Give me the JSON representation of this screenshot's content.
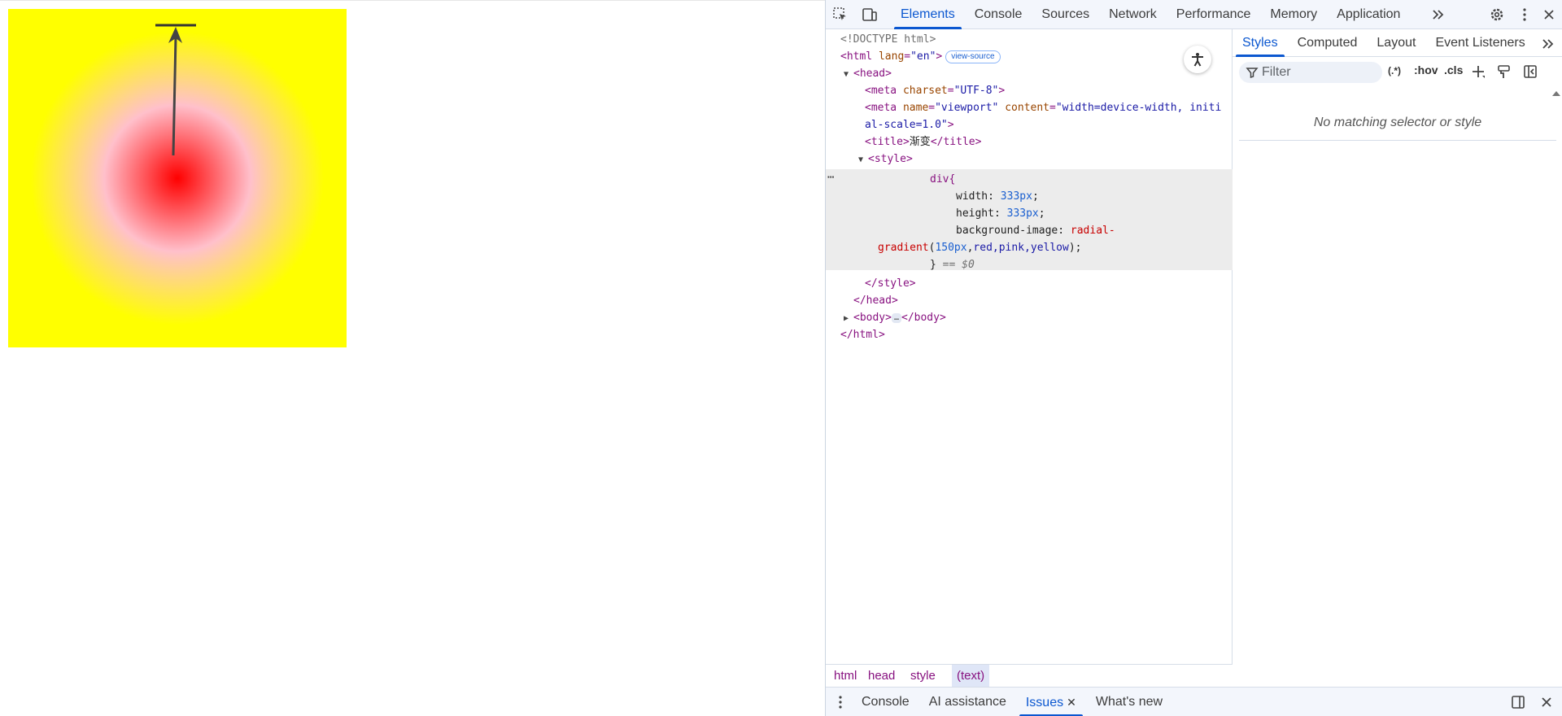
{
  "page": {
    "gradient": {
      "size": "333px",
      "stops": [
        "red",
        "pink",
        "yellow"
      ],
      "radius": "150px"
    }
  },
  "devtools": {
    "main_tabs": [
      {
        "label": "Elements",
        "active": true
      },
      {
        "label": "Console"
      },
      {
        "label": "Sources"
      },
      {
        "label": "Network"
      },
      {
        "label": "Performance"
      },
      {
        "label": "Memory"
      },
      {
        "label": "Application"
      }
    ],
    "dom": {
      "doctype": "<!DOCTYPE html>",
      "html_open": "<html",
      "lang_attr": "lang",
      "lang_val": "\"en\"",
      "html_close_bracket": ">",
      "view_source": "view-source",
      "head_open": "<head>",
      "meta1_open": "<meta",
      "meta1_attr": "charset",
      "meta1_val": "\"UTF-8\"",
      "meta1_close": ">",
      "meta2_open": "<meta",
      "meta2_attr1": "name",
      "meta2_val1": "\"viewport\"",
      "meta2_attr2": "content",
      "meta2_val2a": "\"width=device-width, initi",
      "meta2_val2b": "al-scale=1.0\"",
      "meta2_close": ">",
      "title_open": "<title>",
      "title_text": "渐变",
      "title_close": "</title>",
      "style_open": "<style>",
      "css_selector": "div{",
      "css_width_prop": "width: ",
      "css_width_val": "333px",
      "css_height_prop": "height: ",
      "css_height_val": "333px",
      "css_bg_prop": "background-image: ",
      "css_bg_fn_a": "radial-",
      "css_bg_fn_b": "gradient",
      "css_bg_args_px": "150px",
      "css_bg_args_colors": "red,pink,yellow",
      "css_close": "}",
      "css_dollar": " == $0",
      "style_close": "</style>",
      "head_close": "</head>",
      "body_open": "<body>",
      "body_ellipsis": "…",
      "body_close": "</body>",
      "html_close": "</html>"
    },
    "breadcrumbs": [
      {
        "label": "html"
      },
      {
        "label": "head"
      },
      {
        "label": "style"
      },
      {
        "label": "(text)",
        "active": true
      }
    ],
    "style_tabs": [
      {
        "label": "Styles",
        "active": true
      },
      {
        "label": "Computed"
      },
      {
        "label": "Layout"
      },
      {
        "label": "Event Listeners"
      }
    ],
    "filter": {
      "placeholder": "Filter",
      "regex_label": "(.*)",
      "hov_label": ":hov",
      "cls_label": ".cls"
    },
    "no_match_text": "No matching selector or style",
    "drawer_tabs": [
      {
        "label": "Console"
      },
      {
        "label": "AI assistance"
      },
      {
        "label": "Issues",
        "active": true
      },
      {
        "label": "What's new"
      }
    ]
  },
  "colors": {
    "accent": "#0b57d0",
    "tag": "#881280",
    "attr": "#994500",
    "value": "#1a1aa6"
  }
}
